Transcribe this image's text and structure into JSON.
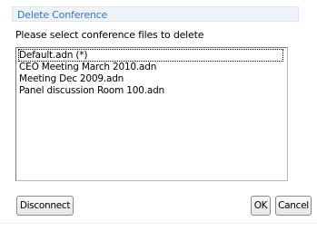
{
  "dialog": {
    "title": "Delete Conference",
    "instruction": "Please select conference files to delete"
  },
  "files": [
    {
      "name": "Default.adn (*)",
      "selected": true
    },
    {
      "name": "CEO Meeting March 2010.adn",
      "selected": false
    },
    {
      "name": "Meeting Dec 2009.adn",
      "selected": false
    },
    {
      "name": "Panel discussion Room 100.adn",
      "selected": false
    }
  ],
  "buttons": {
    "disconnect": "Disconnect",
    "ok": "OK",
    "cancel": "Cancel"
  }
}
